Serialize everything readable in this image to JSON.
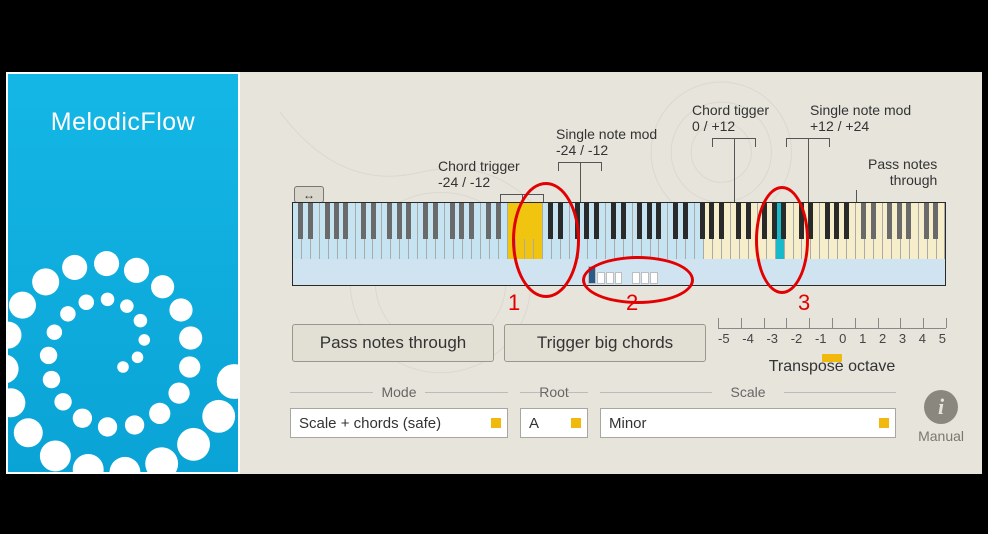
{
  "app": {
    "name": "MelodicFlow"
  },
  "annotations": {
    "chord_trigger_low": {
      "title": "Chord trigger",
      "range": "-24 / -12"
    },
    "single_note_low": {
      "title": "Single note mod",
      "range": "-24 / -12"
    },
    "chord_trigger_hi": {
      "title": "Chord tigger",
      "range": "0 / +12"
    },
    "single_note_hi": {
      "title": "Single note mod",
      "range": "+12 / +24"
    },
    "pass_through": {
      "title": "Pass notes",
      "sub": "through"
    }
  },
  "buttons": {
    "pass_through": "Pass notes through",
    "trigger_chords": "Trigger big chords"
  },
  "transpose": {
    "label": "Transpose octave",
    "ticks": [
      "-5",
      "-4",
      "-3",
      "-2",
      "-1",
      "0",
      "1",
      "2",
      "3",
      "4",
      "5"
    ],
    "value": 0
  },
  "controls": {
    "mode": {
      "label": "Mode",
      "value": "Scale + chords (safe)"
    },
    "root": {
      "label": "Root",
      "value": "A"
    },
    "scale": {
      "label": "Scale",
      "value": "Minor"
    }
  },
  "manual": {
    "label": "Manual"
  },
  "red_marks": {
    "one": "1",
    "two": "2",
    "three": "3"
  },
  "colors": {
    "accent": "#f1b90d",
    "teal": "#18b9c9",
    "brand": "#14b7e6"
  }
}
